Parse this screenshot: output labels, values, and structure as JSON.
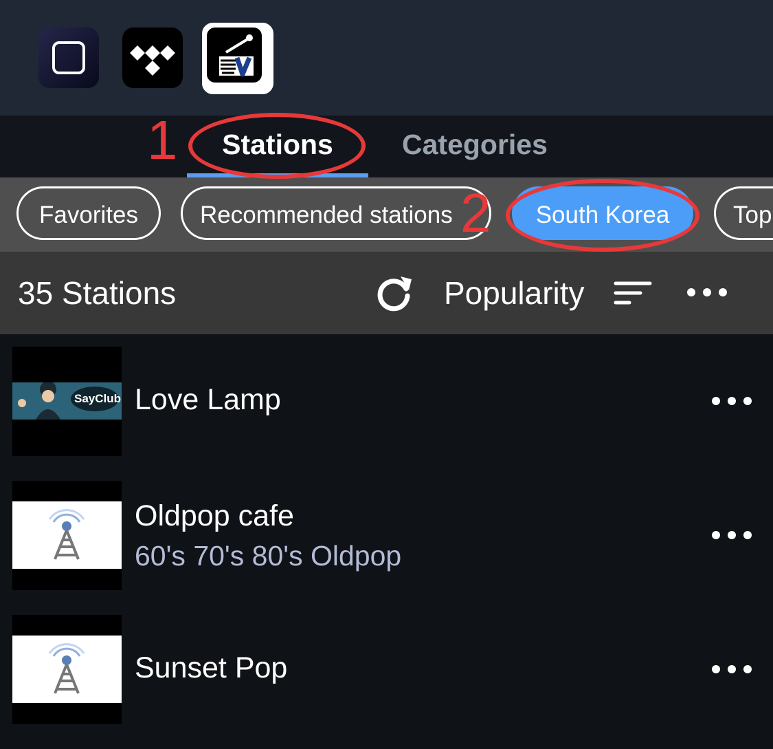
{
  "apps": [
    {
      "name": "roon-app-icon"
    },
    {
      "name": "tidal-app-icon"
    },
    {
      "name": "radio-app-icon"
    }
  ],
  "tabs": {
    "stations": "Stations",
    "categories": "Categories"
  },
  "chips": {
    "favorites": "Favorites",
    "recommended": "Recommended stations",
    "south_korea": "South Korea",
    "top": "Top"
  },
  "list_header": {
    "count": "35 Stations",
    "sort_label": "Popularity"
  },
  "stations": [
    {
      "title": "Love Lamp",
      "subtitle": "",
      "logo_text": "SayClub"
    },
    {
      "title": "Oldpop cafe",
      "subtitle": "60's 70's 80's Oldpop"
    },
    {
      "title": "Sunset Pop",
      "subtitle": ""
    }
  ],
  "annotations": {
    "one": "1",
    "two": "2"
  },
  "colors": {
    "accent": "#4c9df7",
    "annotation": "#e8393a",
    "appbar": "#202835"
  }
}
